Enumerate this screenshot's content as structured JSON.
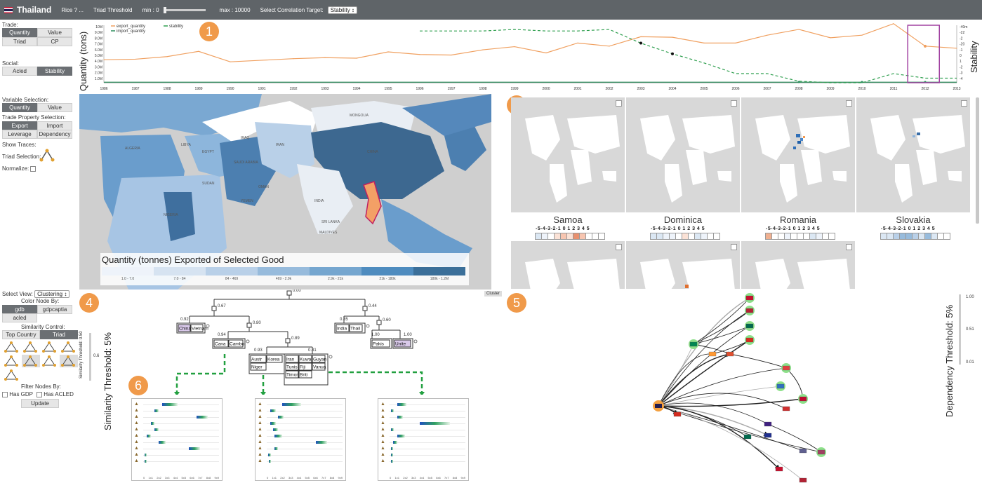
{
  "topbar": {
    "title": "Thailand",
    "product": "Rice ? ...",
    "triad_threshold_label": "Triad Threshold",
    "min_label": "min : 0",
    "max_label": "max : 10000",
    "correlation_label": "Select Correlation Target:",
    "correlation_value": "Stability ↕"
  },
  "left_panel": {
    "trade_label": "Trade:",
    "trade_buttons": [
      "Quantity",
      "Value",
      "Triad",
      "CP"
    ],
    "social_label": "Social:",
    "social_buttons": [
      "Acled",
      "Stability"
    ],
    "variable_label": "Variable Selection:",
    "variable_buttons": [
      "Quantity",
      "Value"
    ],
    "trade_property_label": "Trade Property Selection:",
    "trade_property_buttons": [
      "Export",
      "Import",
      "Leverage",
      "Dependency"
    ],
    "show_traces_label": "Show Traces:",
    "triad_selection_label": "Triad Selection:",
    "normalize_label": "Normalize:",
    "select_view_label": "Select View:",
    "select_view_value": "Clustering ↕",
    "color_node_label": "Color Node By:",
    "color_node_buttons": [
      "gdb",
      "gdpcaptia",
      "acled"
    ],
    "similarity_control_label": "Similarity Control:",
    "similarity_buttons": [
      "Top Country",
      "Triad"
    ],
    "filter_label": "Filter Nodes By:",
    "has_gdp_label": "Has GDP",
    "has_acled_label": "Has ACLED",
    "update_label": "Update",
    "similarity_slider_label": "Similarity Threshold: 0.50",
    "similarity_slider_value": "0.6"
  },
  "badges": [
    "1",
    "2",
    "3",
    "4",
    "5",
    "6"
  ],
  "timeline": {
    "legend": [
      "export_quantity",
      "import_quantity",
      "stability"
    ],
    "ylabel_left": "Quantity (tons)",
    "ylabel_right": "Stability",
    "left_ticks": [
      "10M",
      "9.0M",
      "8.0M",
      "7.0M",
      "6.0M",
      "5.0M",
      "4.0M",
      "3.0M",
      "2.0M",
      "1.0M"
    ],
    "right_ticks": [
      "-40m",
      "-22",
      "-2",
      "-20",
      "-1",
      "0",
      "1",
      "-2",
      "-3",
      "-4"
    ],
    "years": [
      "1995",
      "1996",
      "1997",
      "1998",
      "1999",
      "2000",
      "2001",
      "2002",
      "2003",
      "2004",
      "2005",
      "2006",
      "2007",
      "2008",
      "2009",
      "2010",
      "2011",
      "2012",
      "2013"
    ],
    "colors": {
      "export": "#f0a060",
      "import": "#2f8f5f",
      "stability": "#2f9f4f",
      "highlight": "#a040a0"
    }
  },
  "chart_data": {
    "type": "line",
    "x": [
      "1986",
      "1987",
      "1988",
      "1989",
      "1990",
      "1991",
      "1992",
      "1993",
      "1994",
      "1995",
      "1996",
      "1997",
      "1998",
      "1999",
      "2000",
      "2001",
      "2002",
      "2003",
      "2004",
      "2005",
      "2006",
      "2007",
      "2008",
      "2009",
      "2010",
      "2011",
      "2012",
      "2013"
    ],
    "series": [
      {
        "name": "export_quantity",
        "values": [
          4.4,
          4.5,
          5.0,
          6.0,
          4.0,
          4.3,
          4.6,
          4.8,
          4.7,
          5.9,
          5.4,
          5.3,
          6.3,
          6.9,
          5.7,
          7.6,
          7.0,
          8.8,
          8.7,
          7.6,
          7.6,
          9.1,
          10.2,
          8.6,
          9.1,
          11.3,
          7.0,
          6.6
        ]
      },
      {
        "name": "import_quantity",
        "values": [
          0.1,
          0.1,
          0.1,
          0.1,
          0.1,
          0.1,
          0.1,
          0.1,
          0.1,
          0.1,
          0.1,
          0.1,
          0.1,
          0.1,
          0.1,
          0.1,
          0.1,
          0.1,
          0.1,
          0.1,
          0.1,
          0.1,
          0.1,
          0.1,
          0.1,
          0.1,
          0.1,
          0.1
        ]
      },
      {
        "name": "stability",
        "values": [
          null,
          null,
          null,
          null,
          null,
          null,
          null,
          null,
          null,
          null,
          0.9,
          0.9,
          0.9,
          1.0,
          0.9,
          0.9,
          1.0,
          0.1,
          -0.6,
          -1.2,
          -1.9,
          -1.9,
          -2.4,
          -2.5,
          -2.5,
          -1.9,
          -2.2,
          -2.2
        ]
      }
    ],
    "xlabel": "",
    "ylabel": "Quantity (tons)",
    "ylim": [
      0,
      11
    ]
  },
  "main_map": {
    "legend_title": "Quantity (tonnes) Exported of Selected Good",
    "legend_ticks": [
      "1.0 - 7.0",
      "7.0 - 84",
      "84 - 469",
      "469 - 2.9k",
      "2.9k - 21k",
      "21k - 180k",
      "180k - 1.2M"
    ],
    "legend_colors": [
      "#eef3fa",
      "#d6e3f1",
      "#b9d0e8",
      "#97bbdc",
      "#75a6cf",
      "#4f8cbf",
      "#3b6f99"
    ],
    "labels": [
      "CHINA",
      "MONGOLIA",
      "INDIA",
      "MALDIVES",
      "SAUDI ARABIA",
      "EGYPT",
      "LIBYA",
      "ALGERIA",
      "SUDAN",
      "NIGERIA",
      "IRAN",
      "IRAQ",
      "SRI LANKA",
      "OMAN",
      "YEMEN"
    ]
  },
  "small_maps": [
    {
      "country": "Samoa",
      "scale": "-5-4-3-2-1 0 1 2 3 4 5",
      "colors": [
        "#dbe7f3",
        "#eef3fa",
        "#ffffff",
        "#fbe2d6",
        "#f7c5b0",
        "#fbe2d6",
        "#e8906e",
        "#f7c5b0",
        "#ffffff",
        "#ffffff",
        "#ffffff"
      ]
    },
    {
      "country": "Dominica",
      "scale": "-5-4-3-2-1 0 1 2 3 4 5",
      "colors": [
        "#dbe7f3",
        "#dbe7f3",
        "#eef3fa",
        "#eef3fa",
        "#ffffff",
        "#fbe2d6",
        "#ffffff",
        "#dbe7f3",
        "#eef3fa",
        "#ffffff",
        "#ffffff"
      ]
    },
    {
      "country": "Romania",
      "scale": "-5-4-3-2-1 0 1 2 3 4 5",
      "colors": [
        "#f0b090",
        "#ffffff",
        "#ffffff",
        "#eef3fa",
        "#ffffff",
        "#ffffff",
        "#ffffff",
        "#dbe7f3",
        "#eef3fa",
        "#ffffff",
        "#ffffff"
      ]
    },
    {
      "country": "Slovakia",
      "scale": "-5-4-3-2-1 0 1 2 3 4 5",
      "colors": [
        "#dbe7f3",
        "#dbe7f3",
        "#b9d0e8",
        "#97bbdc",
        "#97bbdc",
        "#b9d0e8",
        "#dbe7f3",
        "#97bbdc",
        "#dbe7f3",
        "#ffffff",
        "#ffffff"
      ]
    }
  ],
  "clustering": {
    "collapse_label": "Cluster",
    "root_value": "0.00",
    "node_values": [
      "0.67",
      "0.44",
      "0.92",
      "0.80",
      "0.85",
      "0.60",
      "0.94",
      "0.89",
      "0.93",
      "0.81",
      "1.00",
      "1.00"
    ],
    "leaves": [
      "China",
      "Vietnam",
      "India",
      "Thail",
      "Pakis",
      "Unite",
      "Cana",
      "Cambo",
      "Austr",
      "Korea",
      "Niger",
      "Iran",
      "Kuwai",
      "Guyan",
      "Tunis",
      "Fiji",
      "Vanua",
      "Timor",
      "Briti"
    ],
    "mini_axis": [
      "0",
      "1x1",
      "2x2",
      "3x3",
      "4x4",
      "5x5",
      "6x6",
      "7x7",
      "8x8",
      "9x9"
    ]
  },
  "dependency": {
    "threshold_label": "Dependency Threshold: 5%",
    "slider_ticks": [
      "1.00",
      "0.51",
      "0.01"
    ]
  },
  "similarity_axis_label": "Similarity Threshold: 5%"
}
